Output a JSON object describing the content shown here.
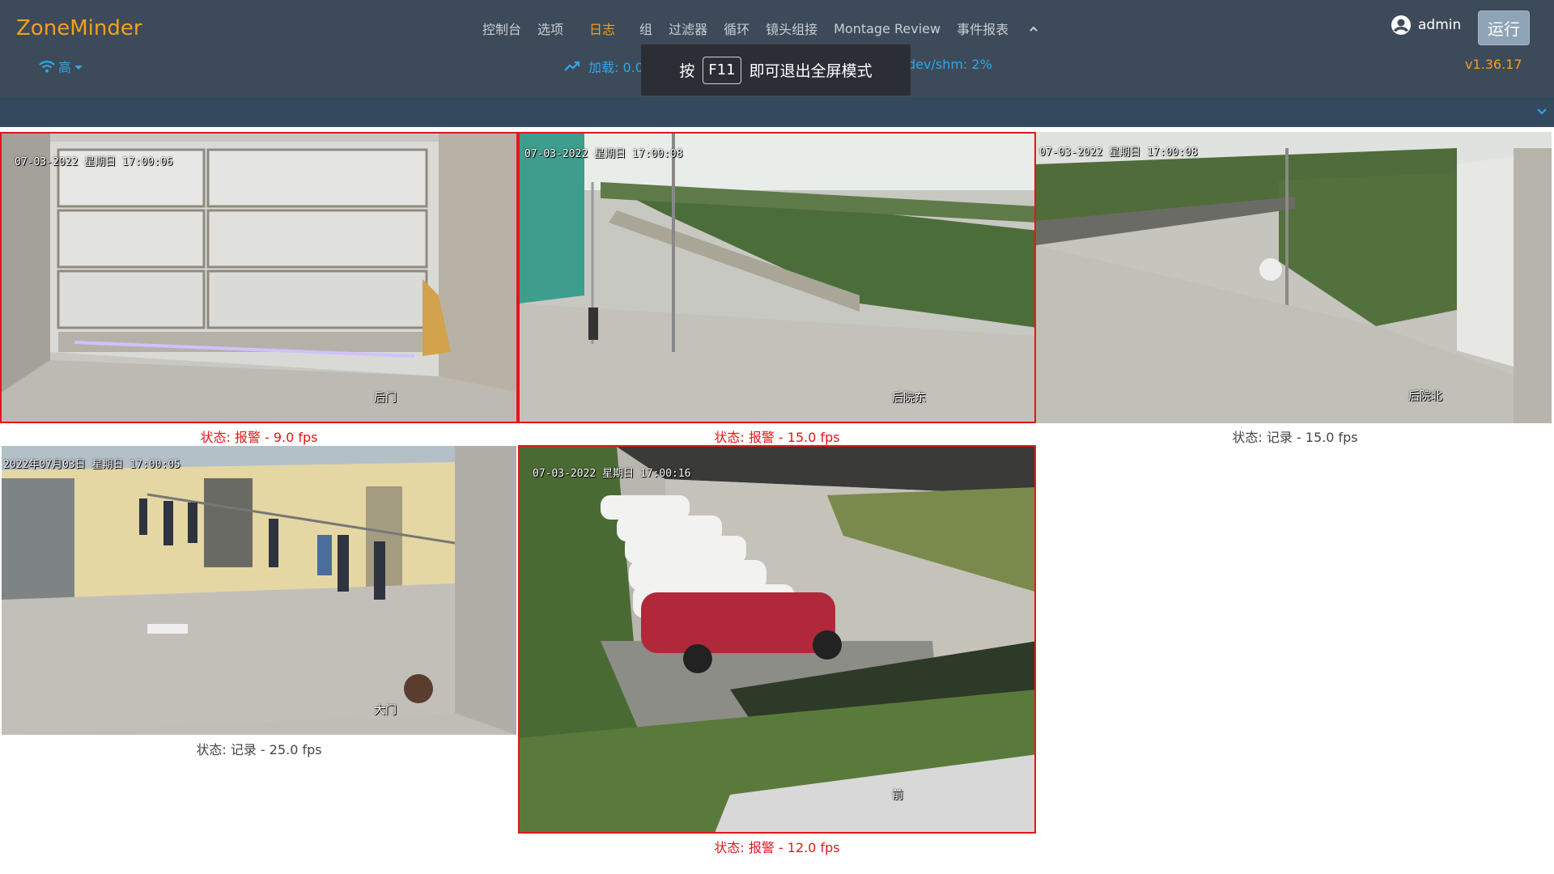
{
  "brand": "ZoneMinder",
  "nav": {
    "items": [
      "控制台",
      "选项",
      "日志",
      "组",
      "过滤器",
      "循环",
      "镜头组接",
      "Montage Review",
      "事件报表"
    ],
    "active": "日志"
  },
  "user": {
    "name": "admin"
  },
  "run_button": "运行",
  "bandwidth": {
    "label": "高"
  },
  "status_bar": {
    "load": "加载: 0.09",
    "shm": "dev/shm: 2%",
    "version": "v1.36.17"
  },
  "fullscreen_notice": {
    "prefix": "按",
    "key": "F11",
    "suffix": "即可退出全屏模式"
  },
  "monitors": [
    {
      "osd_time": "07-03-2022 星期日 17:00:06",
      "name": "后门",
      "status": "状态: 报警 - 9.0 fps",
      "state": "alarm"
    },
    {
      "osd_time": "07-03-2022 星期日 17:00:08",
      "name": "后院东",
      "status": "状态: 报警 - 15.0 fps",
      "state": "alarm"
    },
    {
      "osd_time": "07-03-2022 星期日 17:00:08",
      "name": "后院北",
      "status": "状态: 记录 - 15.0 fps",
      "state": "record"
    },
    {
      "osd_time": "2022年07月03日 星期日 17:00:05",
      "name": "大门",
      "status": "状态: 记录 - 25.0 fps",
      "state": "record"
    },
    {
      "osd_time": "07-03-2022 星期日 17:00:16",
      "name": "前",
      "status": "状态: 报警 - 12.0 fps",
      "state": "alarm"
    }
  ],
  "colors": {
    "nav_bg": "#3d4a59",
    "accent": "#f0a21b",
    "link": "#2ea7e8",
    "alarm": "#e4161a",
    "subbar": "#34495e"
  }
}
